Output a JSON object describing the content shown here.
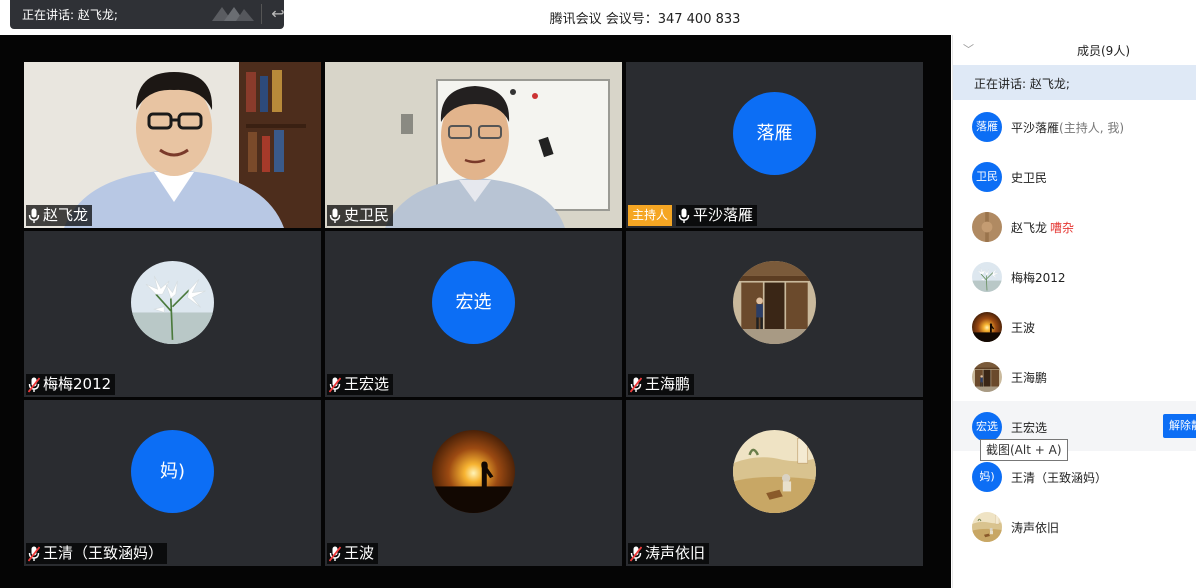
{
  "window": {
    "title": "腾讯会议 会议号：347 400 833"
  },
  "speaking_toast": {
    "text": "正在讲话: 赵飞龙;"
  },
  "video_tiles": [
    {
      "name": "赵飞龙",
      "kind": "camera",
      "muted": false
    },
    {
      "name": "史卫民",
      "kind": "camera",
      "muted": false
    },
    {
      "name": "平沙落雁",
      "kind": "avatar",
      "avatar_text": "落雁",
      "host_label": "主持人",
      "muted": false
    },
    {
      "name": "梅梅2012",
      "kind": "photo",
      "photo": "white-lily",
      "muted": true
    },
    {
      "name": "王宏选",
      "kind": "avatar",
      "avatar_text": "宏选",
      "muted": true
    },
    {
      "name": "王海鹏",
      "kind": "photo",
      "photo": "man-at-doorway",
      "muted": true
    },
    {
      "name": "王清（王致涵妈）",
      "kind": "avatar",
      "avatar_text": "妈)",
      "muted": true
    },
    {
      "name": "王波",
      "kind": "photo",
      "photo": "sunset-silhouette",
      "muted": true
    },
    {
      "name": "涛声依旧",
      "kind": "photo",
      "photo": "classical-painting",
      "muted": true
    }
  ],
  "panel": {
    "title": "成员(9人)",
    "speaking_text": "正在讲话: 赵飞龙;",
    "members": [
      {
        "avatar_text": "落雁",
        "name": "平沙落雁",
        "sub": "(主持人, 我)"
      },
      {
        "avatar_text": "卫民",
        "name": "史卫民"
      },
      {
        "photo": "wood-portrait",
        "name": "赵飞龙",
        "status": "嘈杂"
      },
      {
        "photo": "white-lily",
        "name": "梅梅2012"
      },
      {
        "photo": "sunset-silhouette",
        "name": "王波"
      },
      {
        "photo": "man-at-doorway",
        "name": "王海鹏"
      },
      {
        "avatar_text": "宏选",
        "name": "王宏选",
        "action": "解除静音"
      },
      {
        "avatar_text": "妈)",
        "name": "王清（王致涵妈）"
      },
      {
        "photo": "classical-painting",
        "name": "涛声依旧"
      }
    ]
  },
  "tooltip": {
    "text": "截图(Alt + A)"
  },
  "colors": {
    "accent": "#0c6ef5",
    "host_badge": "#f5a623",
    "noisy": "#e53935",
    "video_bg": "#050505",
    "tile_bg": "#2a2c30"
  }
}
